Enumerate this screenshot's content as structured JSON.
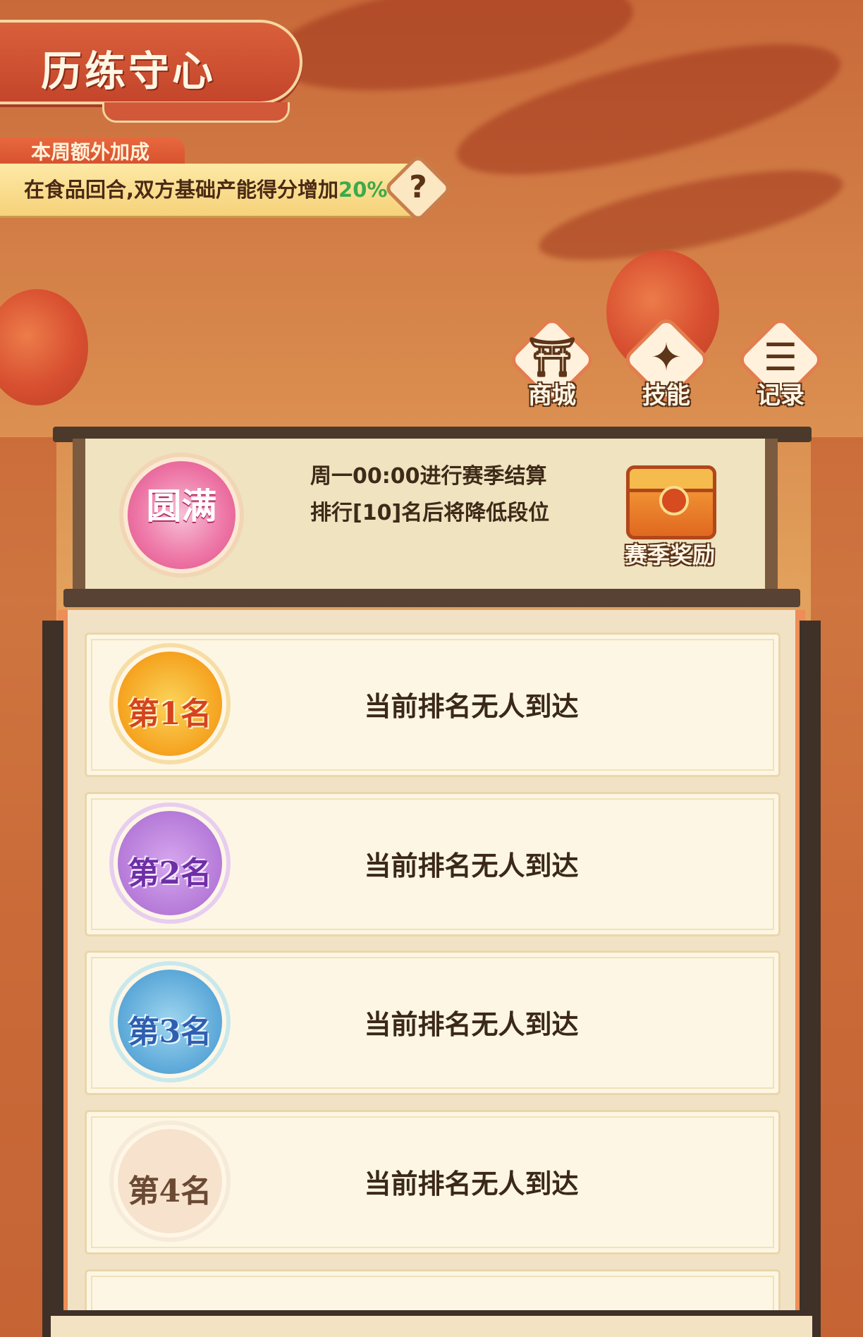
{
  "header": {
    "title": "历练守心"
  },
  "bonus": {
    "tab_label": "本周额外加成",
    "text_before": "在食品回合,双方基础产能得分增加",
    "percent": "20%",
    "help_glyph": "?"
  },
  "side_buttons": [
    {
      "label": "商城",
      "icon": "shop-icon"
    },
    {
      "label": "技能",
      "icon": "skill-icon"
    },
    {
      "label": "记录",
      "icon": "record-icon"
    }
  ],
  "season": {
    "badge_text": "圆满",
    "line1": "周一00:00进行赛季结算",
    "line2": "排行[10]名后将降低段位",
    "reward_label": "赛季奖励"
  },
  "ranking": [
    {
      "badge": "第1名",
      "status": "当前排名无人到达"
    },
    {
      "badge": "第2名",
      "status": "当前排名无人到达"
    },
    {
      "badge": "第3名",
      "status": "当前排名无人到达"
    },
    {
      "badge": "第4名",
      "status": "当前排名无人到达"
    }
  ],
  "colors": {
    "accent": "#e9683e",
    "panel": "#fdf6e4",
    "bonus_percent": "#3caa4a"
  }
}
